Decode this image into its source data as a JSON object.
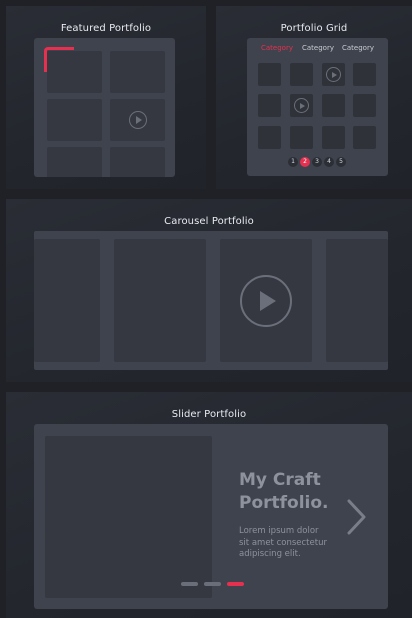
{
  "featured": {
    "title": "Featured Portfolio"
  },
  "grid": {
    "title": "Portfolio Grid",
    "tabs": [
      "Category",
      "Category",
      "Category"
    ],
    "active_tab": 0,
    "pages": [
      "1",
      "2",
      "3",
      "4",
      "5"
    ],
    "active_page": 1
  },
  "carousel": {
    "title": "Carousel Portfolio"
  },
  "slider": {
    "title": "Slider Portfolio",
    "heading_line1": "My Craft",
    "heading_line2": "Portfolio.",
    "desc_line1": "Lorem ipsum dolor",
    "desc_line2": "sit amet consectetur",
    "desc_line3": "adipiscing elit.",
    "slide_count": 3,
    "active_slide": 2
  },
  "colors": {
    "accent": "#e5304f",
    "background": "#1f2127",
    "card": "#3f434d",
    "tile": "#353841"
  },
  "icons": [
    "play-icon",
    "chevron-right-icon",
    "corner-bracket-icon"
  ]
}
